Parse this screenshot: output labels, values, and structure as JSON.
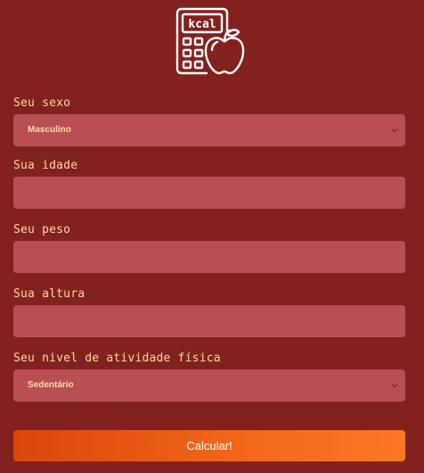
{
  "logo": {
    "icon": "calculator-apple-icon",
    "text": "kcal"
  },
  "form": {
    "sex": {
      "label": "Seu sexo",
      "selected": "Masculino"
    },
    "age": {
      "label": "Sua idade",
      "value": ""
    },
    "weight": {
      "label": "Seu peso",
      "value": ""
    },
    "height": {
      "label": "Sua altura",
      "value": ""
    },
    "activity": {
      "label": "Seu nivel de atividade física",
      "selected": "Sedentário"
    },
    "submit_label": "Calcular!"
  },
  "colors": {
    "background": "#83211f",
    "field": "#b84f53",
    "label": "#ffd6a0",
    "button_start": "#d9460a",
    "button_end": "#fb7824"
  }
}
